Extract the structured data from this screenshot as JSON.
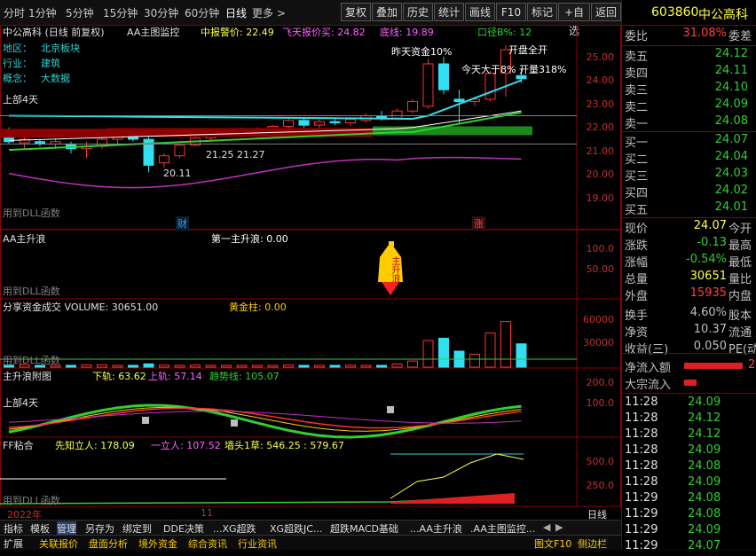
{
  "toolbar": {
    "periods": [
      "分时",
      "1分钟",
      "5分钟",
      "15分钟",
      "30分钟",
      "60分钟",
      "日线",
      "更多 >"
    ],
    "buttons": [
      "复权",
      "叠加",
      "历史",
      "统计",
      "画线",
      "F10",
      "标记",
      "+自选",
      "返回"
    ]
  },
  "main_panel": {
    "title": "中公高科 (日线 前复权)",
    "indicator": "AA主图监控",
    "alert": "中报警价: 22.49",
    "fly": "飞天报价买: 24.82",
    "bottom_line": "底线: 19.89",
    "path": "口径B%: 12",
    "info_labels": [
      "地区：",
      "行业：",
      "概念："
    ],
    "info_values": [
      "北京板块",
      "建筑",
      "大数据"
    ],
    "ann_yesterday": "昨天资金10%",
    "ann_today": "今天大于8%",
    "ann_open": "开盘全开",
    "ann_volume": "开量318%",
    "ann_left": "上部4天",
    "ann_mid": "21.25   21.27",
    "ann_low": "20.11",
    "dll_note": "用到DLL函数",
    "badge_fin": "财",
    "badge_up": "涨",
    "y_ticks": [
      "25.00",
      "24.00",
      "23.00",
      "22.00",
      "21.00",
      "20.00",
      "19.00"
    ]
  },
  "panel2": {
    "title": "AA主升浪",
    "label": "第一主升浪: 0.00",
    "note": "用到DLL函数",
    "bell_text": "主升浪",
    "y_ticks": [
      "100.0",
      "50.00"
    ]
  },
  "panel3": {
    "title": "分享资金成交 VOLUME: 30651.00",
    "gold": "黄金柱: 0.00",
    "note": "用到DLL函数",
    "y_ticks": [
      "60000",
      "30000"
    ]
  },
  "panel4": {
    "title": "主升浪附图",
    "lower": "下轨: 63.62",
    "upper": "上轨: 57.14",
    "trend": "趋势线: 105.07",
    "ann": "上部4天",
    "y_ticks": [
      "200.0",
      "100.0"
    ]
  },
  "panel5": {
    "title": "FF粘合",
    "prophet": "先知立人: 178.09",
    "standing": "一立人: 107.52",
    "wall": "墙头1草: 546.25 : 579.67",
    "note": "用到DLL函数",
    "y_ticks": [
      "500.0",
      "250.0"
    ]
  },
  "x_axis": {
    "year": "2022年",
    "month": "11",
    "mode": "日线"
  },
  "bottom_tabs": [
    "指标",
    "模板",
    "管理",
    "另存为",
    "绑定到",
    "DDE决策",
    "...XG超跌",
    "XG超跌JC...",
    "超跌MACD基础",
    "...AA主升浪",
    ".AA主图监控..."
  ],
  "status": {
    "items": [
      "扩展",
      "关联报价",
      "盘面分析",
      "境外资金",
      "综合资讯",
      "行业资讯"
    ],
    "right": [
      "图文F10",
      "侧边栏"
    ],
    "tabs": [
      "笔",
      "价",
      "细",
      "势",
      "联"
    ]
  },
  "quote": {
    "code": "603860",
    "name": "中公高科",
    "weibi_label": "委比",
    "weibi": "31.08%",
    "weicha_label": "委差",
    "sells": [
      {
        "label": "卖五",
        "price": "24.12"
      },
      {
        "label": "卖四",
        "price": "24.11"
      },
      {
        "label": "卖三",
        "price": "24.10"
      },
      {
        "label": "卖二",
        "price": "24.09"
      },
      {
        "label": "卖一",
        "price": "24.08"
      }
    ],
    "buys": [
      {
        "label": "买一",
        "price": "24.07"
      },
      {
        "label": "买二",
        "price": "24.04"
      },
      {
        "label": "买三",
        "price": "24.03"
      },
      {
        "label": "买四",
        "price": "24.02"
      },
      {
        "label": "买五",
        "price": "24.01"
      }
    ],
    "stats": [
      {
        "label": "现价",
        "value": "24.07",
        "extra": "今开",
        "color": "#ffff40"
      },
      {
        "label": "涨跌",
        "value": "-0.13",
        "extra": "最高",
        "color": "#30d030"
      },
      {
        "label": "涨幅",
        "value": "-0.54%",
        "extra": "最低",
        "color": "#30d030"
      },
      {
        "label": "总量",
        "value": "30651",
        "extra": "量比",
        "color": "#ffff40"
      },
      {
        "label": "外盘",
        "value": "15935",
        "extra": "内盘",
        "color": "#ff4040"
      },
      {
        "label": "换手",
        "value": "4.60%",
        "extra": "股本",
        "color": "#c0c0c0"
      },
      {
        "label": "净资",
        "value": "10.37",
        "extra": "流通",
        "color": "#c0c0c0"
      },
      {
        "label": "收益(三)",
        "value": "0.050",
        "extra": "PE(动",
        "color": "#c0c0c0"
      }
    ],
    "netflow_label": "净流入额",
    "netflow_value": "2",
    "bigflow_label": "大宗流入",
    "ticks": [
      {
        "time": "11:28",
        "price": "24.09"
      },
      {
        "time": "11:28",
        "price": "24.12"
      },
      {
        "time": "11:28",
        "price": "24.12"
      },
      {
        "time": "11:28",
        "price": "24.09"
      },
      {
        "time": "11:28",
        "price": "24.08"
      },
      {
        "time": "11:28",
        "price": "24.09"
      },
      {
        "time": "11:29",
        "price": "24.08"
      },
      {
        "time": "11:29",
        "price": "24.08"
      },
      {
        "time": "11:29",
        "price": "24.09"
      },
      {
        "time": "11:29",
        "price": "24.07"
      }
    ]
  },
  "chart_data": {
    "type": "candlestick",
    "candles": [
      {
        "o": 21.8,
        "h": 22.0,
        "l": 21.3,
        "c": 21.4
      },
      {
        "o": 21.35,
        "h": 21.6,
        "l": 21.1,
        "c": 21.5
      },
      {
        "o": 21.4,
        "h": 21.5,
        "l": 21.2,
        "c": 21.3
      },
      {
        "o": 21.3,
        "h": 21.55,
        "l": 21.1,
        "c": 21.4
      },
      {
        "o": 21.3,
        "h": 21.4,
        "l": 20.9,
        "c": 21.1
      },
      {
        "o": 21.1,
        "h": 21.4,
        "l": 20.7,
        "c": 21.2
      },
      {
        "o": 21.2,
        "h": 21.6,
        "l": 21.1,
        "c": 21.5
      },
      {
        "o": 21.5,
        "h": 21.8,
        "l": 21.3,
        "c": 21.7
      },
      {
        "o": 21.7,
        "h": 21.85,
        "l": 21.4,
        "c": 21.5
      },
      {
        "o": 21.5,
        "h": 21.6,
        "l": 20.1,
        "c": 20.4
      },
      {
        "o": 20.5,
        "h": 20.9,
        "l": 20.3,
        "c": 20.8
      },
      {
        "o": 20.8,
        "h": 21.3,
        "l": 20.7,
        "c": 21.25
      },
      {
        "o": 21.25,
        "h": 21.6,
        "l": 21.2,
        "c": 21.55
      },
      {
        "o": 21.55,
        "h": 21.8,
        "l": 21.4,
        "c": 21.7
      },
      {
        "o": 21.7,
        "h": 21.9,
        "l": 21.6,
        "c": 21.85
      },
      {
        "o": 21.8,
        "h": 22.0,
        "l": 21.6,
        "c": 21.9
      },
      {
        "o": 21.9,
        "h": 22.0,
        "l": 21.8,
        "c": 21.95
      },
      {
        "o": 21.95,
        "h": 22.1,
        "l": 21.9,
        "c": 22.05
      },
      {
        "o": 22.05,
        "h": 22.4,
        "l": 21.95,
        "c": 22.3
      },
      {
        "o": 22.3,
        "h": 22.4,
        "l": 22.0,
        "c": 22.1
      },
      {
        "o": 22.1,
        "h": 22.35,
        "l": 21.9,
        "c": 22.25
      },
      {
        "o": 22.25,
        "h": 22.4,
        "l": 22.1,
        "c": 22.2
      },
      {
        "o": 22.2,
        "h": 22.4,
        "l": 22.05,
        "c": 22.35
      },
      {
        "o": 22.3,
        "h": 22.6,
        "l": 22.2,
        "c": 22.5
      },
      {
        "o": 22.5,
        "h": 22.7,
        "l": 22.3,
        "c": 22.4
      },
      {
        "o": 22.4,
        "h": 22.8,
        "l": 22.35,
        "c": 22.7
      },
      {
        "o": 22.7,
        "h": 23.2,
        "l": 22.6,
        "c": 23.1
      },
      {
        "o": 22.9,
        "h": 24.9,
        "l": 22.8,
        "c": 24.7
      },
      {
        "o": 24.7,
        "h": 25.0,
        "l": 23.4,
        "c": 23.6
      },
      {
        "o": 23.2,
        "h": 23.6,
        "l": 22.2,
        "c": 23.1
      },
      {
        "o": 23.1,
        "h": 23.3,
        "l": 22.9,
        "c": 23.2
      },
      {
        "o": 23.2,
        "h": 24.4,
        "l": 23.1,
        "c": 24.3
      },
      {
        "o": 24.3,
        "h": 25.5,
        "l": 23.3,
        "c": 25.3
      },
      {
        "o": 24.2,
        "h": 24.5,
        "l": 23.9,
        "c": 24.07
      }
    ],
    "volumes": [
      2500,
      3200,
      1800,
      2100,
      1500,
      2900,
      3100,
      2200,
      2000,
      4300,
      2600,
      1900,
      2700,
      2100,
      2400,
      1800,
      2200,
      1600,
      2800,
      2100,
      2300,
      1900,
      2500,
      2000,
      2300,
      4200,
      8000,
      35000,
      38000,
      21000,
      17000,
      45000,
      60000,
      30651
    ]
  }
}
